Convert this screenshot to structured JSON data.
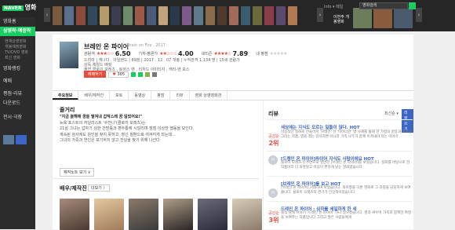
{
  "logo": {
    "brand": "NAVER",
    "text": "영화"
  },
  "top": {
    "user": "Info ▾ 메일",
    "search_text": "영화검색"
  },
  "side_promo_label": "이번주 개봉영화",
  "nav": {
    "items": [
      {
        "label": "영화홈",
        "active": false
      },
      {
        "label": "상영작·예정작",
        "active": true
      }
    ],
    "subs": [
      "현재상영영화",
      "개봉예정영화",
      "TV/DVD 영화",
      "최신 영화"
    ],
    "sections": [
      "영화랭킹",
      "예매",
      "평점·리뷰",
      "다운로드"
    ],
    "footer": "전시·극장"
  },
  "movie": {
    "title": "브레인 온 파이어",
    "subtitle": "Brain on Fire , 2017",
    "audience_label": "관람객",
    "audience_score": "6.50",
    "critic_label": "기자·평론가",
    "critic_score": "4.00",
    "netizen_label": "네티즌",
    "netizen_score": "7.89",
    "my_rating": "내 평점",
    "genre_row": "드라마 | 캐나다 , 아일랜드 | 89분 | 2017 . 12 . 07 개봉 | 누적관객 1,134 명 | 15세 관람가",
    "director_row": "감독 제럴드 배럿",
    "cast_row": "출연 클로이 모레츠 , 토머스 맨 , 리처드 아미티지 , 캐리-앤 모스",
    "reserve_label": "예매하기",
    "like_count": "305"
  },
  "tabs": [
    "주요정보",
    "배우/제작진",
    "포토",
    "동영상",
    "평점",
    "리뷰",
    "영화 상영영화관"
  ],
  "synopsis": {
    "title": "줄거리",
    "headline": "\"지금 올해에 꿈을 떨쳐내 갑작스레 꿈 잃었어요!\"",
    "lines": [
      "뉴욕 포스트의 저널리스트 '수잔나'(클로이 모레츠)는",
      "21살 그녀는 갑자기 심한 건망증과 편두통에 시달리며 점점 이상한 행동을 보인다.",
      "계속된 검사에도 원인을 찾지 못하고, 정신 질환으로 여겨지게 되는데...",
      "그녀의 가족과 연인은 포기하지 않고 진실을 찾기 위해 나선다"
    ],
    "more": "제작노트 보기 ∨"
  },
  "cast_section": {
    "title": "배우/제작진",
    "more": "더보기 〉"
  },
  "reviews": {
    "title": "리뷰",
    "sort": "최신순 ▾",
    "write": "리뷰쓰기",
    "items": [
      {
        "rank_label": "공감순",
        "rank": "2위",
        "title": "세상에는 지식도 모르는 일들이 많다. HOT",
        "body": "감동적인 실화로 만들어져 '브레인' 한 '마이너한' 병 사례를 통해 한 가정의 갈등과 회복을 그리는 작품, 병을 겪는 당사자뿐 아니라 가족 모두가 함께 이겨내야 하는 이야기"
      },
      {
        "rank_label": "",
        "rank": "",
        "title": "[드렝인 온 파이어]파이어 지식도 사람이에요 HOT",
        "body": "클로이 모레츠가 주연으로 열연한 [브레인 온 파이어]를 보았습니다. 실화를 바탕으로 한 작품이라 더 와닿았고 마음이 짠하게 남는 영화였습니다"
      },
      {
        "rank_label": "",
        "rank": "",
        "title": "[브레인 온 파이어]를 보고 HOT",
        "body": "[브레인 온 파이어] 기대하며 보았습니다. 희귀병을 다룬 영화로 그 과정을 담담하게 보여줍니다. 클로이 모레츠의 연기가 인상적이었습니다"
      },
      {
        "rank_label": "공감순",
        "rank": "3위",
        "title": "드레인 온 파이어 : 심하를 세밀하게 한 세",
        "body": "솔직 담백 이야기 '드레인 온 파이어' 하나 일으켰습니다. 병과 싸우며 가족과 함께한 여정을 보여주는 작품입니다 그리고 많은 사람들에게"
      }
    ]
  },
  "colors": {
    "brand_green": "#19ce60",
    "accent_red": "#e74b3c",
    "link_blue": "#3b66c5"
  }
}
